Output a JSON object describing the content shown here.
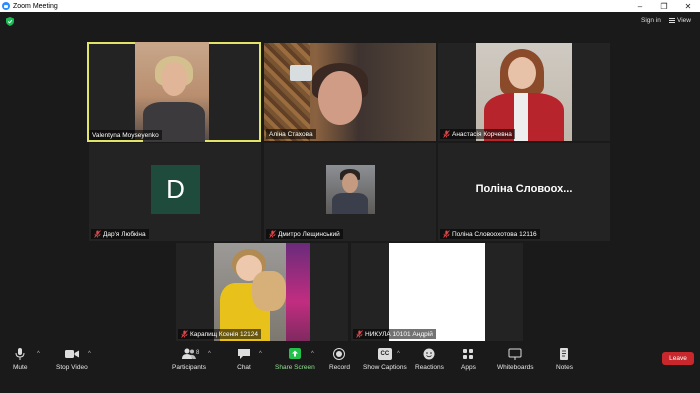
{
  "window": {
    "title": "Zoom Meeting",
    "controls": [
      "–",
      "❐",
      "✕"
    ]
  },
  "topbar": {
    "sign_in": "Sign in",
    "view": "View"
  },
  "participants_tiles": [
    {
      "name": "Valentyna Moyseyenko",
      "muted": false,
      "active_speaker": true
    },
    {
      "name": "Аліна Стахова",
      "muted": false,
      "active_speaker": false
    },
    {
      "name": "Анастасія Корчевна",
      "muted": true,
      "active_speaker": false
    },
    {
      "name": "Дар'я Любкіна",
      "muted": true,
      "avatar_letter": "D",
      "avatar_color": "#1e4b3c"
    },
    {
      "name": "Дмитро Лещинський",
      "muted": true
    },
    {
      "name": "Поліна Словоохотова 12116",
      "muted": true,
      "display_title": "Поліна Словоох..."
    },
    {
      "name": "Карапищ Ксенія 12124",
      "muted": true
    },
    {
      "name": "НИКУЛА 10101 Андрій",
      "muted": true
    }
  ],
  "toolbar": {
    "mute": "Mute",
    "stop_video": "Stop Video",
    "participants": "Participants",
    "participants_count": "8",
    "chat": "Chat",
    "share_screen": "Share Screen",
    "record": "Record",
    "show_captions": "Show Captions",
    "captions_badge": "CC",
    "reactions": "Reactions",
    "apps": "Apps",
    "whiteboards": "Whiteboards",
    "notes": "Notes",
    "leave": "Leave"
  },
  "colors": {
    "active_speaker_border": "#e2e46a",
    "share_screen_green": "#23c04a",
    "leave_red": "#c8272c",
    "muted_mic_red": "#e0484a"
  }
}
